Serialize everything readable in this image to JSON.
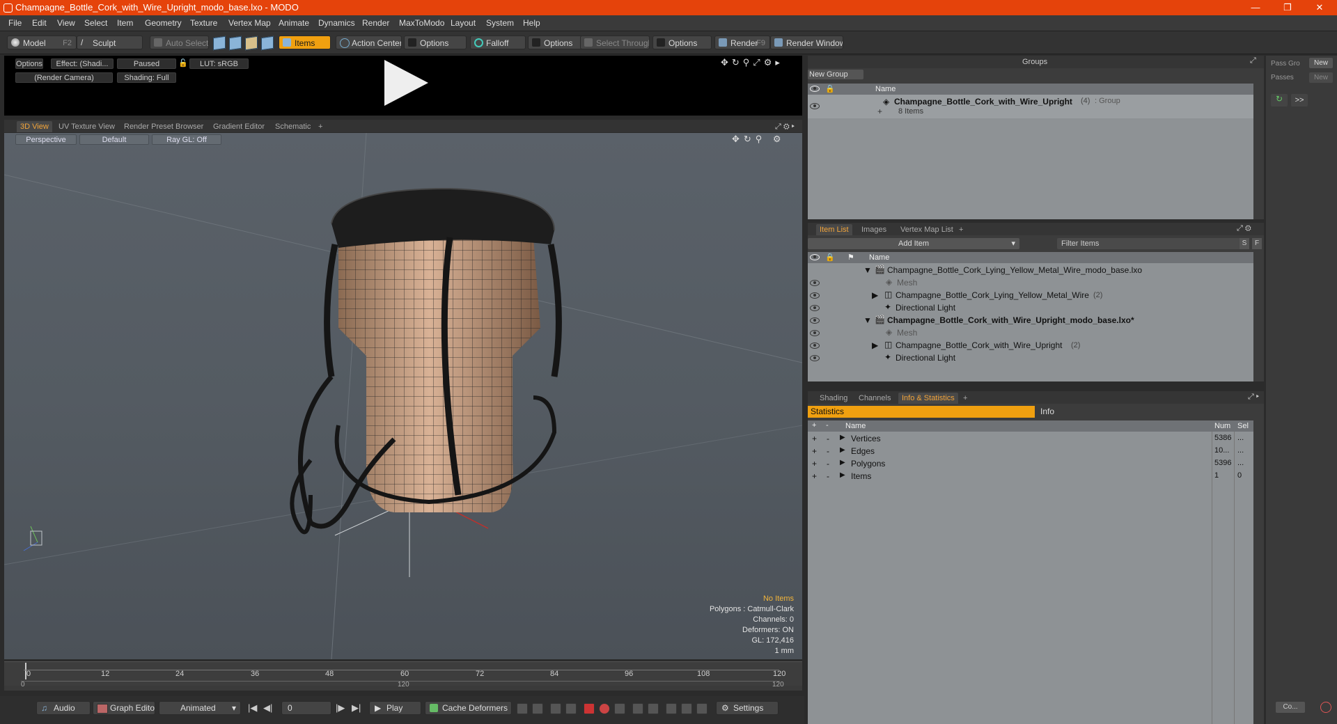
{
  "window": {
    "title": "Champagne_Bottle_Cork_with_Wire_Upright_modo_base.lxo - MODO",
    "controls": [
      "—",
      "❐",
      "✕"
    ]
  },
  "menu": [
    "File",
    "Edit",
    "View",
    "Select",
    "Item",
    "Geometry",
    "Texture",
    "Vertex Map",
    "Animate",
    "Dynamics",
    "Render",
    "MaxToModo",
    "Layout",
    "System",
    "Help"
  ],
  "toolbar": {
    "model": "Model",
    "model_key": "F2",
    "sculpt": "Sculpt",
    "auto_select": "Auto Select",
    "items": "Items",
    "action_center": "Action Center",
    "options1": "Options",
    "falloff": "Falloff",
    "options2": "Options",
    "select_through": "Select Through",
    "options3": "Options",
    "render": "Render",
    "render_key": "F9",
    "render_window": "Render Window"
  },
  "preview": {
    "options": "Options",
    "effect": "Effect: (Shadi...",
    "paused": "Paused",
    "lut": "LUT: sRGB",
    "camera": "(Render Camera)",
    "shading": "Shading: Full"
  },
  "viewport_tabs": [
    "3D View",
    "UV Texture View",
    "Render Preset Browser",
    "Gradient Editor",
    "Schematic",
    "+"
  ],
  "viewport": {
    "perspective": "Perspective",
    "default": "Default",
    "raygl": "Ray GL: Off",
    "hud": {
      "no_items": "No Items",
      "polygons": "Polygons : Catmull-Clark",
      "channels": "Channels: 0",
      "deformers": "Deformers: ON",
      "gl": "GL: 172,416",
      "unit": "1 mm"
    }
  },
  "timeline": {
    "ticks": [
      "0",
      "12",
      "24",
      "36",
      "48",
      "60",
      "72",
      "84",
      "96",
      "108",
      "120"
    ],
    "range_start": "0",
    "range_mid": "120",
    "range_end": "120"
  },
  "bottombar": {
    "audio": "Audio",
    "graph_editor": "Graph Editor",
    "animated": "Animated",
    "frame": "0",
    "play": "Play",
    "cache_deformers": "Cache Deformers",
    "settings": "Settings"
  },
  "groups": {
    "title": "Groups",
    "new_group": "New Group",
    "col_name": "Name",
    "group_name": "Champagne_Bottle_Cork_with_Wire_Upright",
    "group_count": "(4)",
    "group_type": ": Group",
    "group_items": "8 Items"
  },
  "pass": {
    "pass_groups": "Pass Gro",
    "new1": "New",
    "passes": "Passes",
    "new2": "New",
    "more": ">>",
    "collapse": "Co..."
  },
  "itemlist": {
    "tabs": [
      "Item List",
      "Images",
      "Vertex Map List",
      "+"
    ],
    "add_item": "Add Item",
    "filter": "Filter Items",
    "s": "S",
    "f": "F",
    "col_name": "Name",
    "rows": [
      {
        "label": "Champagne_Bottle_Cork_Lying_Yellow_Metal_Wire_modo_base.lxo",
        "suffix": ""
      },
      {
        "label": "Mesh",
        "suffix": ""
      },
      {
        "label": "Champagne_Bottle_Cork_Lying_Yellow_Metal_Wire",
        "suffix": "(2)"
      },
      {
        "label": "Directional Light",
        "suffix": ""
      },
      {
        "label": "Champagne_Bottle_Cork_with_Wire_Upright_modo_base.lxo*",
        "suffix": ""
      },
      {
        "label": "Mesh",
        "suffix": ""
      },
      {
        "label": "Champagne_Bottle_Cork_with_Wire_Upright",
        "suffix": "(2)"
      },
      {
        "label": "Directional Light",
        "suffix": ""
      }
    ]
  },
  "stats": {
    "tabs": [
      "Shading",
      "Channels",
      "Info & Statistics",
      "+"
    ],
    "sub_tabs": [
      "Statistics",
      "Info"
    ],
    "col_plus": "+",
    "col_minus": "-",
    "col_name": "Name",
    "col_num": "Num",
    "col_sel": "Sel",
    "rows": [
      {
        "name": "Vertices",
        "num": "5386",
        "sel": "..."
      },
      {
        "name": "Edges",
        "num": "10...",
        "sel": "..."
      },
      {
        "name": "Polygons",
        "num": "5396",
        "sel": "..."
      },
      {
        "name": "Items",
        "num": "1",
        "sel": "0"
      }
    ]
  }
}
